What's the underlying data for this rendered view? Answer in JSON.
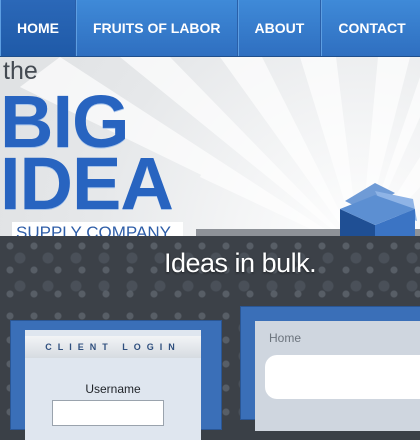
{
  "nav": {
    "items": [
      {
        "label": "HOME",
        "active": true
      },
      {
        "label": "FRUITS OF LABOR",
        "active": false
      },
      {
        "label": "ABOUT",
        "active": false
      },
      {
        "label": "CONTACT",
        "active": false
      }
    ]
  },
  "logo": {
    "the": "the",
    "big": "BIG",
    "idea": "IDEA",
    "supply": "SUPPLY COMPANY",
    "icon": "cube-icon"
  },
  "tagline": "Ideas in bulk.",
  "login": {
    "title": "CLIENT LOGIN",
    "username_label": "Username",
    "username_value": ""
  },
  "main": {
    "breadcrumb": "Home"
  },
  "colors": {
    "nav_blue": "#3a7fd0",
    "logo_blue": "#2864c0",
    "panel_blue": "#3a6fb8",
    "dark_pattern": "#3c4148"
  }
}
